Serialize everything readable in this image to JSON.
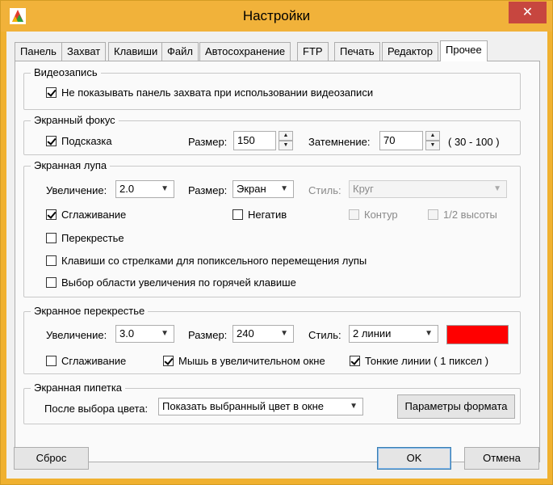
{
  "window": {
    "title": "Настройки",
    "close_glyph": "✕"
  },
  "tabs": [
    "Панель",
    "Захват",
    "Клавиши",
    "Файл",
    "Автосохранение",
    "FTP",
    "Печать",
    "Редактор",
    "Прочее"
  ],
  "active_tab": "Прочее",
  "video": {
    "title": "Видеозапись",
    "hide_panel": {
      "label": "Не показывать панель захвата при использовании видеозаписи",
      "checked": true
    }
  },
  "focus": {
    "title": "Экранный фокус",
    "hint": {
      "label": "Подсказка",
      "checked": true
    },
    "size_label": "Размер:",
    "size_value": "150",
    "dim_label": "Затемнение:",
    "dim_value": "70",
    "range": "( 30 - 100 )"
  },
  "magnifier": {
    "title": "Экранная лупа",
    "zoom_label": "Увеличение:",
    "zoom_value": "2.0",
    "size_label": "Размер:",
    "size_value": "Экран",
    "style_label": "Стиль:",
    "style_value": "Круг",
    "smoothing": {
      "label": "Сглаживание",
      "checked": true
    },
    "negative": {
      "label": "Негатив",
      "checked": false
    },
    "outline": {
      "label": "Контур",
      "checked": false
    },
    "half_height": {
      "label": "1/2 высоты",
      "checked": false
    },
    "crosshair": {
      "label": "Перекрестье",
      "checked": false
    },
    "arrow_keys": {
      "label": "Клавиши со стрелками для попиксельного перемещения лупы",
      "checked": false
    },
    "hotkey_area": {
      "label": "Выбор области увеличения по горячей клавише",
      "checked": false
    }
  },
  "crosshair": {
    "title": "Экранное перекрестье",
    "zoom_label": "Увеличение:",
    "zoom_value": "3.0",
    "size_label": "Размер:",
    "size_value": "240",
    "style_label": "Стиль:",
    "style_value": "2 линии",
    "color": "#ff0000",
    "smoothing": {
      "label": "Сглаживание",
      "checked": false
    },
    "mouse_in_zoom": {
      "label": "Мышь в увеличительном окне",
      "checked": true
    },
    "thin_lines": {
      "label": "Тонкие линии ( 1 пиксел )",
      "checked": true
    }
  },
  "pipette": {
    "title": "Экранная пипетка",
    "after_label": "После выбора цвета:",
    "after_value": "Показать выбранный цвет в окне",
    "format_button": "Параметры формата"
  },
  "buttons": {
    "reset": "Сброс",
    "ok": "OK",
    "cancel": "Отмена"
  },
  "icons": {
    "app": "app-logo-icon",
    "close": "close-icon",
    "dropdown": "chevron-down-icon"
  }
}
